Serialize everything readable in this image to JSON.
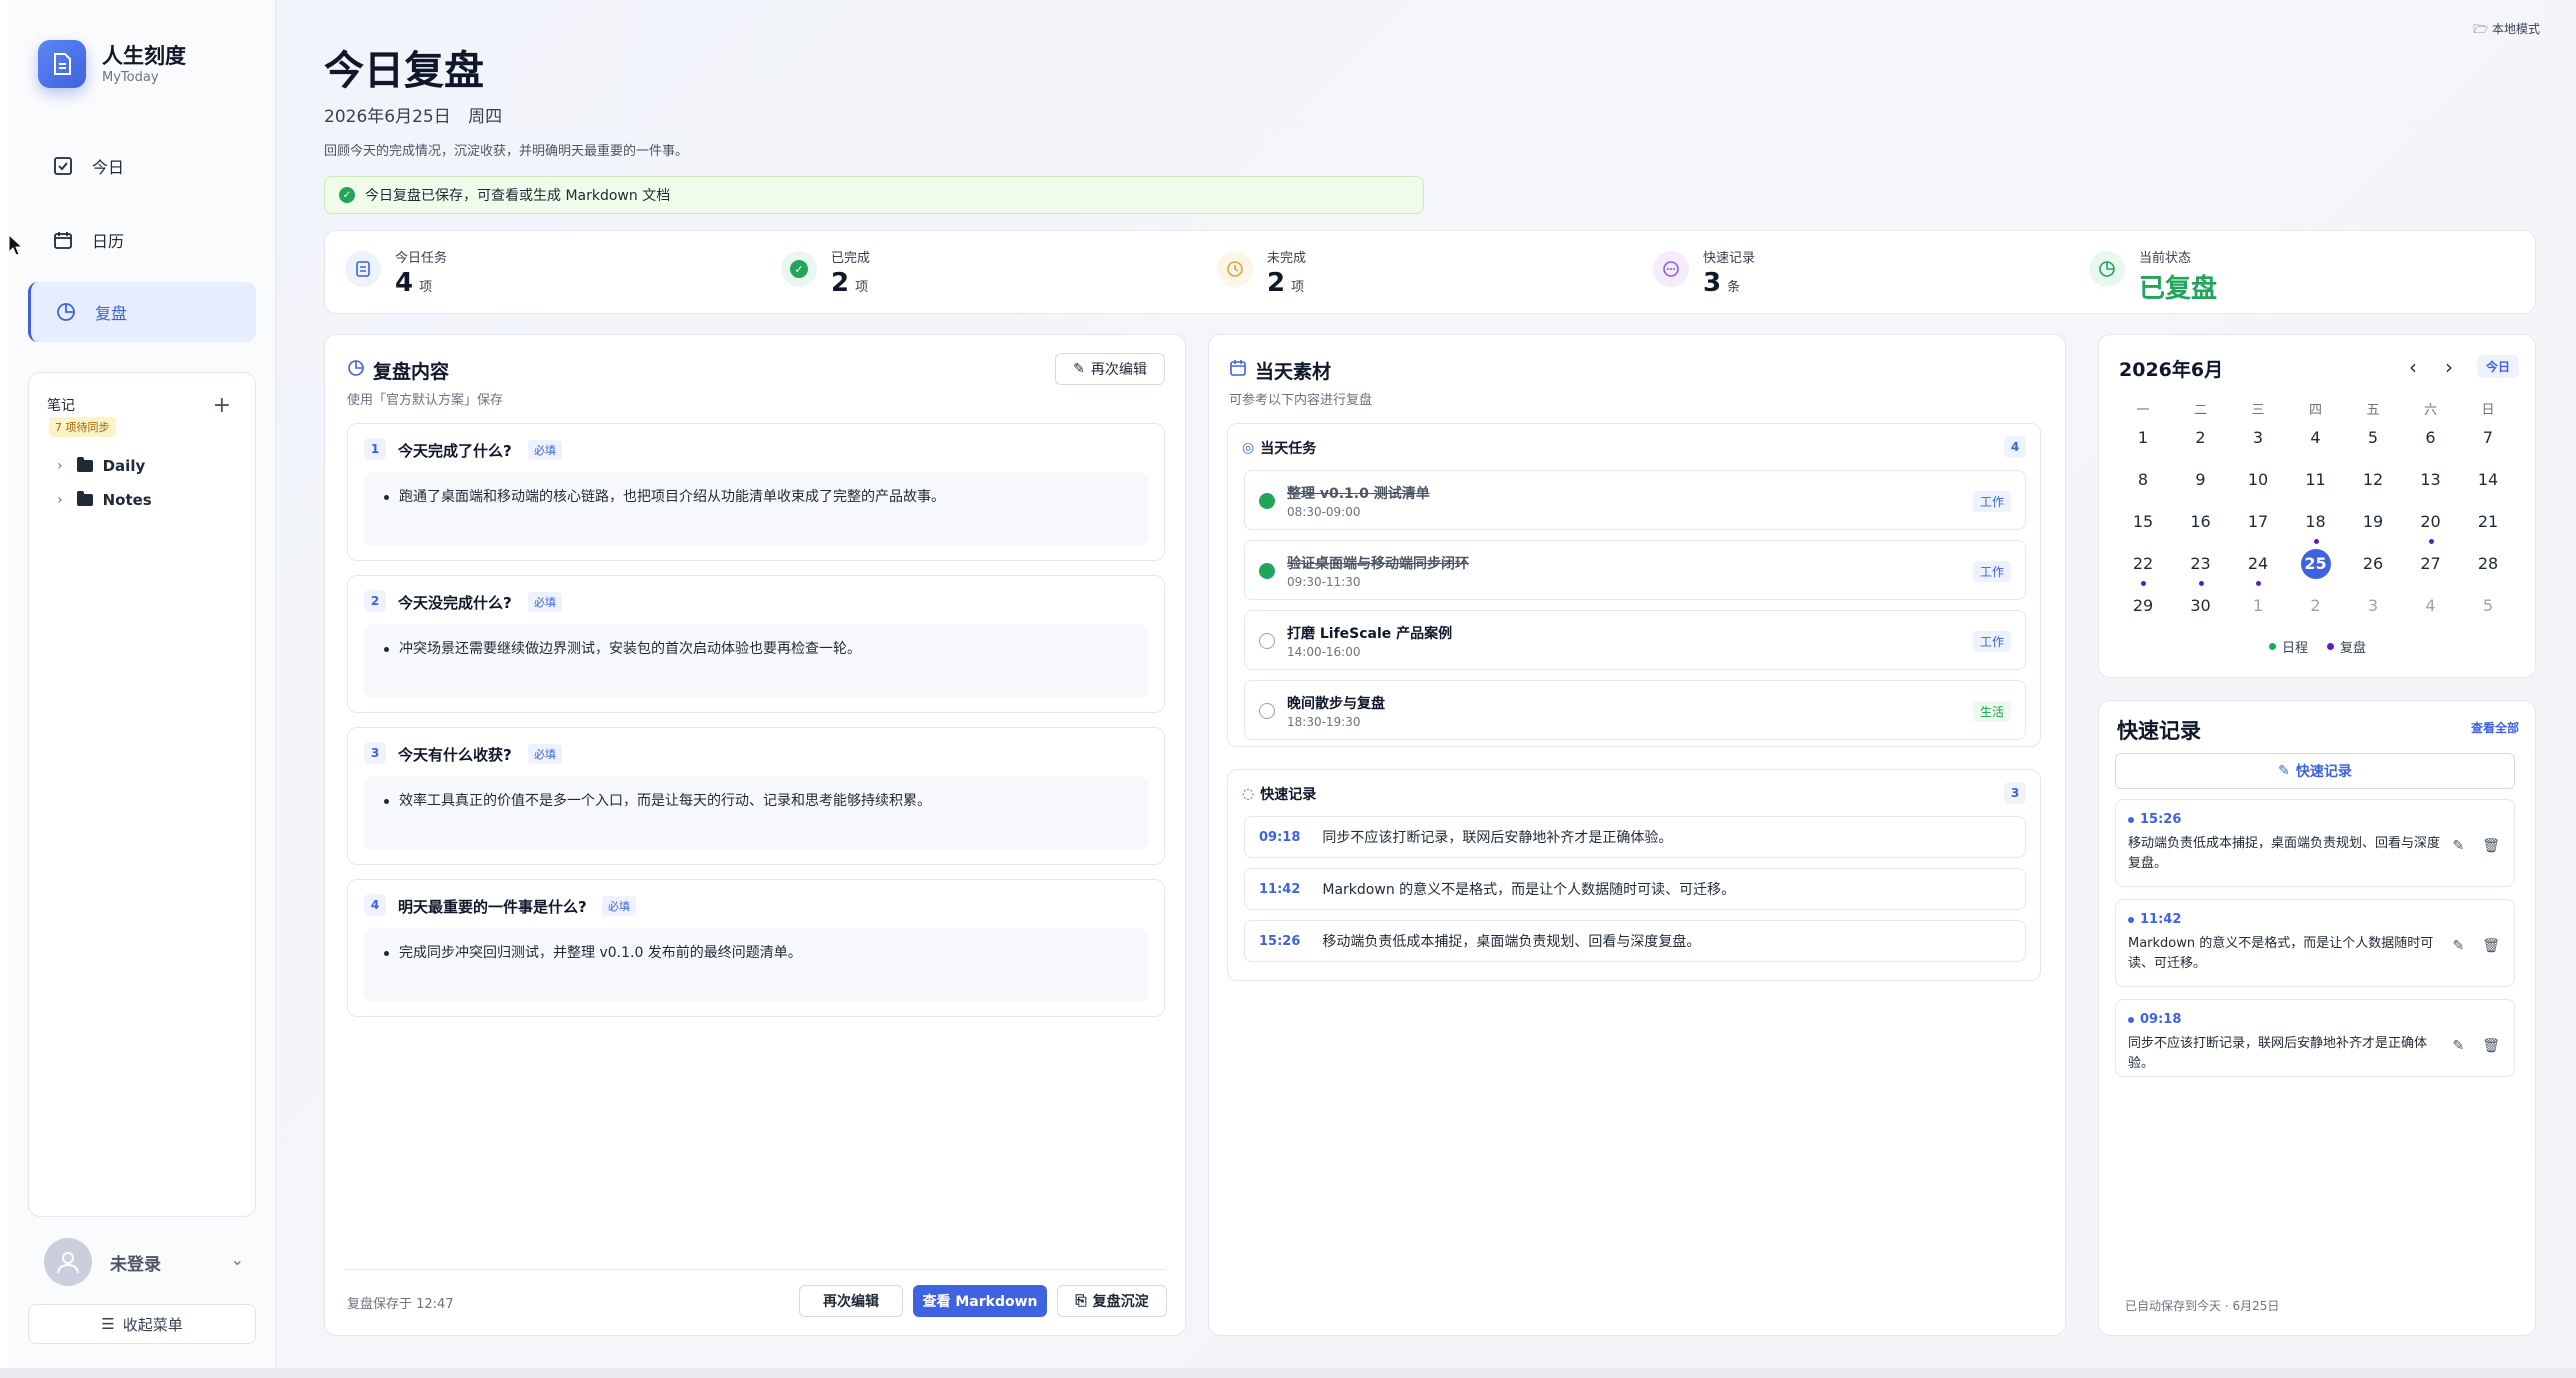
{
  "brand": {
    "title": "人生刻度",
    "subtitle": "MyToday"
  },
  "nav": [
    {
      "label": "今日"
    },
    {
      "label": "日历"
    },
    {
      "label": "复盘"
    }
  ],
  "notes": {
    "title": "笔记",
    "sync_badge": "7 项待同步",
    "folders": [
      "Daily",
      "Notes"
    ]
  },
  "user": {
    "name": "未登录"
  },
  "collapse_label": "收起菜单",
  "local_mode": "本地模式",
  "header": {
    "title": "今日复盘",
    "date": "2026年6月25日 周四",
    "desc": "回顾今天的完成情况，沉淀收获，并明确明天最重要的一件事。",
    "saved_msg": "今日复盘已保存，可查看或生成 Markdown 文档"
  },
  "stats": [
    {
      "label": "今日任务",
      "value": "4",
      "unit": "项"
    },
    {
      "label": "已完成",
      "value": "2",
      "unit": "项"
    },
    {
      "label": "未完成",
      "value": "2",
      "unit": "项"
    },
    {
      "label": "快速记录",
      "value": "3",
      "unit": "条"
    },
    {
      "label": "当前状态",
      "value": "已复盘",
      "unit": ""
    }
  ],
  "review": {
    "title": "复盘内容",
    "subtitle": "使用「官方默认方案」保存",
    "edit_label": "再次编辑",
    "questions": [
      {
        "num": "1",
        "title": "今天完成了什么?",
        "tag": "必填",
        "answer": "跑通了桌面端和移动端的核心链路，也把项目介绍从功能清单收束成了完整的产品故事。"
      },
      {
        "num": "2",
        "title": "今天没完成什么?",
        "tag": "必填",
        "answer": "冲突场景还需要继续做边界测试，安装包的首次启动体验也要再检查一轮。"
      },
      {
        "num": "3",
        "title": "今天有什么收获?",
        "tag": "必填",
        "answer": "效率工具真正的价值不是多一个入口，而是让每天的行动、记录和思考能够持续积累。"
      },
      {
        "num": "4",
        "title": "明天最重要的一件事是什么?",
        "tag": "必填",
        "answer": "完成同步冲突回归测试，并整理 v0.1.0 发布前的最终问题清单。"
      }
    ],
    "saved_at": "复盘保存于 12:47",
    "btn_edit": "再次编辑",
    "btn_markdown": "查看 Markdown",
    "btn_archive": "复盘沉淀"
  },
  "materials": {
    "title": "当天素材",
    "subtitle": "可参考以下内容进行复盘",
    "tasks_title": "当天任务",
    "tasks_count": "4",
    "tasks": [
      {
        "title": "整理 v0.1.0 测试清单",
        "time": "08:30-09:00",
        "tag": "工作",
        "done": true
      },
      {
        "title": "验证桌面端与移动端同步闭环",
        "time": "09:30-11:30",
        "tag": "工作",
        "done": true
      },
      {
        "title": "打磨 LifeScale 产品案例",
        "time": "14:00-16:00",
        "tag": "工作",
        "done": false
      },
      {
        "title": "晚间散步与复盘",
        "time": "18:30-19:30",
        "tag": "生活",
        "done": false
      }
    ],
    "memos_title": "快速记录",
    "memos_count": "3",
    "memos": [
      {
        "time": "09:18",
        "text": "同步不应该打断记录，联网后安静地补齐才是正确体验。"
      },
      {
        "time": "11:42",
        "text": "Markdown 的意义不是格式，而是让个人数据随时可读、可迁移。"
      },
      {
        "time": "15:26",
        "text": "移动端负责低成本捕捉，桌面端负责规划、回看与深度复盘。"
      }
    ]
  },
  "calendar": {
    "title": "2026年6月",
    "today_label": "今日",
    "weekdays": [
      "一",
      "二",
      "三",
      "四",
      "五",
      "六",
      "日"
    ],
    "weeks": [
      [
        "1",
        "2",
        "3",
        "4",
        "5",
        "6",
        "7"
      ],
      [
        "8",
        "9",
        "10",
        "11",
        "12",
        "13",
        "14"
      ],
      [
        "15",
        "16",
        "17",
        "18",
        "19",
        "20",
        "21"
      ],
      [
        "22",
        "23",
        "24",
        "25",
        "26",
        "27",
        "28"
      ],
      [
        "29",
        "30",
        "1",
        "2",
        "3",
        "4",
        "5"
      ]
    ],
    "selected": "25",
    "legend_schedule": "日程",
    "legend_review": "复盘"
  },
  "quick": {
    "title": "快速记录",
    "view_all": "查看全部",
    "add_label": "快速记录",
    "items": [
      {
        "time": "15:26",
        "text": "移动端负责低成本捕捉，桌面端负责规划、回看与深度复盘。"
      },
      {
        "time": "11:42",
        "text": "Markdown 的意义不是格式，而是让个人数据随时可读、可迁移。"
      },
      {
        "time": "09:18",
        "text": "同步不应该打断记录，联网后安静地补齐才是正确体验。"
      }
    ],
    "autosave": "已自动保存到今天 · 6月25日"
  },
  "colors": {
    "accent": "#3d63e0",
    "done": "#22a55b",
    "review": "#5b21b6"
  }
}
